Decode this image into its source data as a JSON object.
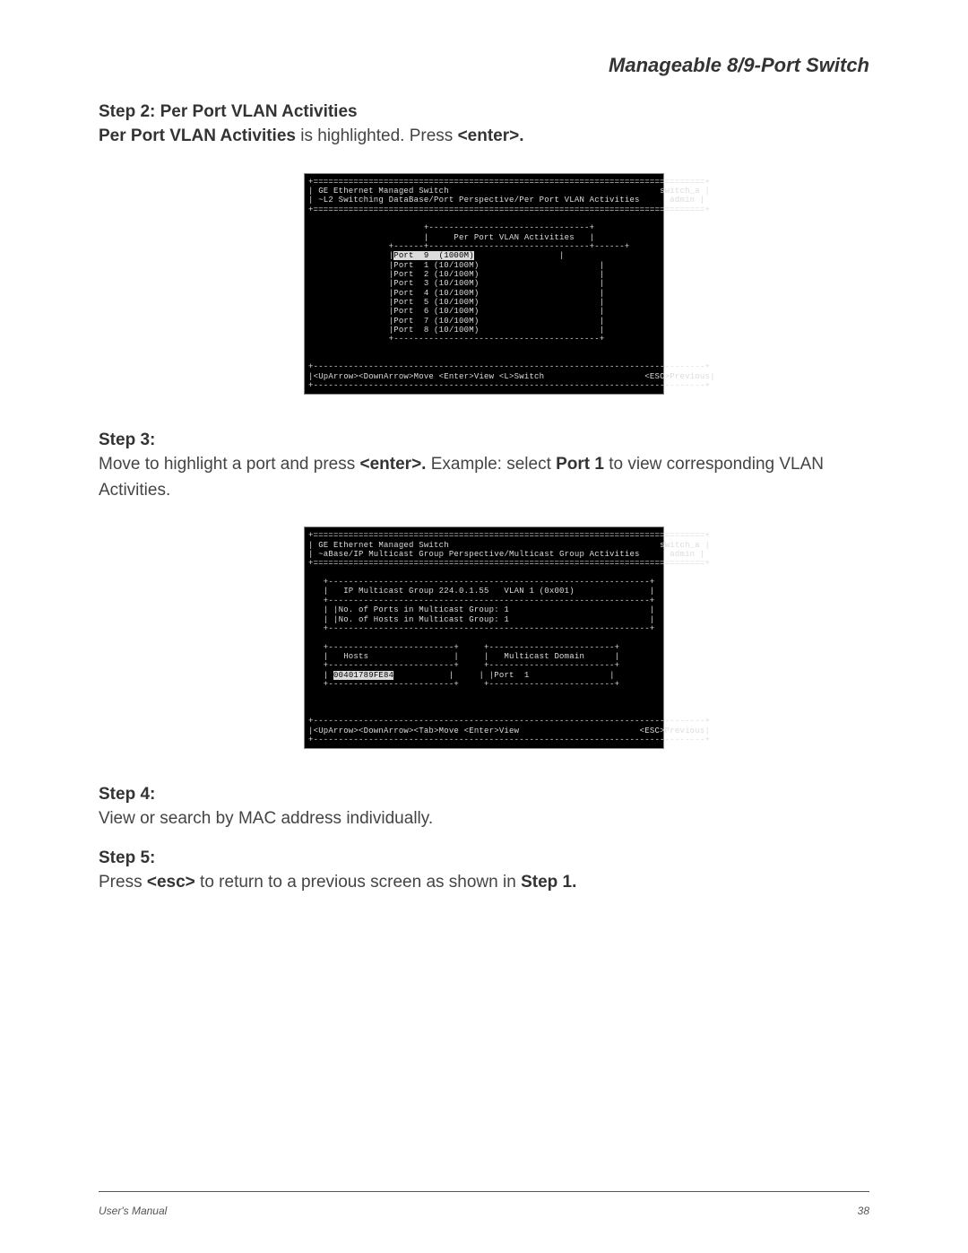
{
  "doc_title": "Manageable 8/9-Port Switch",
  "step2": {
    "heading": "Step 2: Per Port VLAN Activities",
    "prefix_bold": "Per Port VLAN Activities",
    "text_after": " is highlighted. Press ",
    "enter": "<enter>.",
    "tail": ""
  },
  "term1": {
    "line_top": "+==============================================================================+",
    "line_t1_left": "| GE Ethernet Managed Switch",
    "line_t1_right": "switch_a |",
    "line_t2_left": "| ~L2 Switching DataBase/Port Perspective/Per Port VLAN Activities",
    "line_t2_right": "admin |",
    "line_sep": "+==============================================================================+",
    "box_top": "                       +--------------------------------+",
    "box_title": "                       |     Per Port VLAN Activities   |",
    "box_sep": "                +------+--------------------------------+------+",
    "row_sel": "                |",
    "row_sel_inv": "Port  9  (1000M)",
    "row_sel_end": "                 |",
    "rows": [
      "                |Port  1 (10/100M)                        |",
      "                |Port  2 (10/100M)                        |",
      "                |Port  3 (10/100M)                        |",
      "                |Port  4 (10/100M)                        |",
      "                |Port  5 (10/100M)                        |",
      "                |Port  6 (10/100M)                        |",
      "                |Port  7 (10/100M)                        |",
      "                |Port  8 (10/100M)                        |"
    ],
    "box_bot": "                +-----------------------------------------+",
    "spacer1": "",
    "spacer2": "",
    "footer_sep": "+------------------------------------------------------------------------------+",
    "footer_left": "|<UpArrow><DownArrow>Move <Enter>View <L>Switch",
    "footer_right": "<ESC>Previous|",
    "footer_bot": "+------------------------------------------------------------------------------+"
  },
  "step3": {
    "heading": "Step 3:",
    "text1": "Move to highlight a port and press ",
    "enter": "<enter>.",
    "text2": " Example: select ",
    "port1": "Port 1",
    "text3": " to view corresponding VLAN Activities."
  },
  "term2": {
    "line_top": "+==============================================================================+",
    "line_t1_left": "| GE Ethernet Managed Switch",
    "line_t1_right": "switch_a |",
    "line_t2_left": "| ~aBase/IP Multicast Group Perspective/Multicast Group Activities",
    "line_t2_right": "admin |",
    "line_sep": "+==============================================================================+",
    "box1_top": "   +----------------------------------------------------------------+",
    "box1_l1": "   |   IP Multicast Group 224.0.1.55   VLAN 1 (0x001)               |",
    "box1_mid": "   +----------------------------------------------------------------+",
    "box1_l2": "   | |No. of Ports in Multicast Group: 1                            |",
    "box1_l3": "   | |No. of Hosts in Multicast Group: 1                            |",
    "box1_bot": "   +----------------------------------------------------------------+",
    "cols_top": "   +-------------------------+     +-------------------------+",
    "cols_hdr": "   |   Hosts                 |     |   Multicast Domain      |",
    "cols_mid": "   +-------------------------+     +-------------------------+",
    "cols_row_pre": "   | ",
    "cols_row_inv": "00401789FE84",
    "cols_row_mid": "           |     | |Port  1                |",
    "cols_bot": "   +-------------------------+     +-------------------------+",
    "spacer1": "",
    "spacer2": "",
    "spacer3": "",
    "footer_sep": "+------------------------------------------------------------------------------+",
    "footer_left": "|<UpArrow><DownArrow><Tab>Move <Enter>View",
    "footer_right": "<ESC>Previous|",
    "footer_bot": "+------------------------------------------------------------------------------+"
  },
  "step4": {
    "heading": "Step 4:",
    "text": "View or search by MAC address individually."
  },
  "step5": {
    "heading": "Step 5:",
    "text1": "Press ",
    "esc": "<esc>",
    "text2": " to return to a previous screen as shown in ",
    "step1": "Step 1.",
    "tail": ""
  },
  "footer": {
    "left": "User's Manual",
    "right": "38"
  }
}
